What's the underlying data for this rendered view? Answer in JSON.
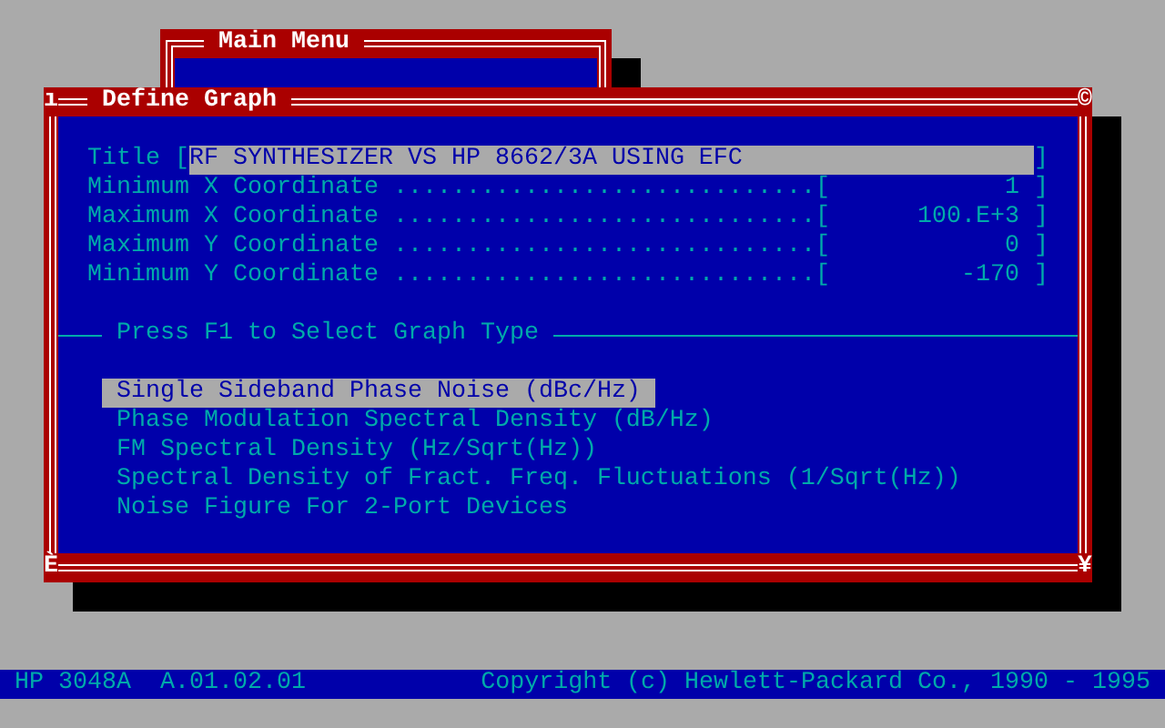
{
  "main_menu": {
    "title": "Main Menu"
  },
  "define_graph": {
    "title": "Define Graph",
    "corners": [
      "ı",
      "©",
      "È",
      "¥"
    ],
    "title_field": {
      "label": "Title",
      "open": "[",
      "value": "RF SYNTHESIZER VS HP 8662/3A USING EFC",
      "close": "]"
    },
    "coordinates": [
      {
        "label": "Minimum X Coordinate",
        "leader": ".............................",
        "open": "[",
        "value": "1",
        "close": "]"
      },
      {
        "label": "Maximum X Coordinate",
        "leader": ".............................",
        "open": "[",
        "value": "100.E+3",
        "close": "]"
      },
      {
        "label": "Maximum Y Coordinate",
        "leader": ".............................",
        "open": "[",
        "value": "0",
        "close": "]"
      },
      {
        "label": "Minimum Y Coordinate",
        "leader": ".............................",
        "open": "[",
        "value": "-170",
        "close": "]"
      }
    ],
    "section_label": "Press F1 to Select Graph Type",
    "graph_types": [
      {
        "label": "Single Sideband Phase Noise (dBc/Hz)",
        "selected": true
      },
      {
        "label": "Phase Modulation Spectral Density (dB/Hz)",
        "selected": false
      },
      {
        "label": "FM Spectral Density (Hz/Sqrt(Hz))",
        "selected": false
      },
      {
        "label": "Spectral Density of Fract. Freq. Fluctuations (1/Sqrt(Hz))",
        "selected": false
      },
      {
        "label": "Noise Figure For 2-Port Devices",
        "selected": false
      }
    ]
  },
  "status_bar": {
    "left": "HP 3048A  A.01.02.01",
    "right": "Copyright (c) Hewlett-Packard Co., 1990 - 1995"
  }
}
